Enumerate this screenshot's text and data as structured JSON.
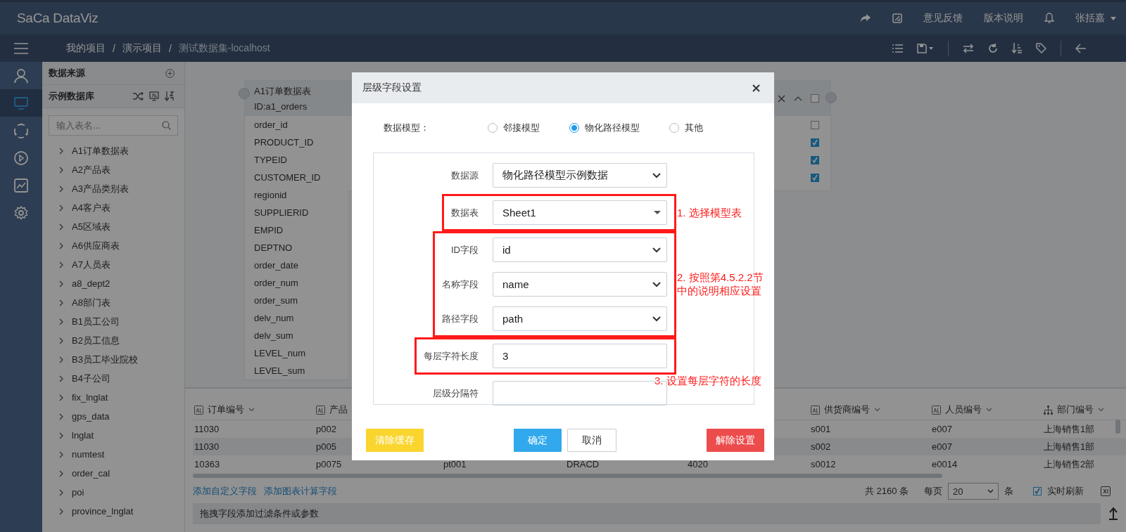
{
  "header": {
    "logo": "SaCa DataViz",
    "links": [
      "意见反馈",
      "版本说明"
    ],
    "user": "张括嘉"
  },
  "breadcrumb": {
    "items": [
      "我的项目",
      "演示项目",
      "测试数据集-localhost"
    ],
    "separator": "/"
  },
  "rail": [
    {
      "kind": "user",
      "selected": false
    },
    {
      "kind": "monitor",
      "selected": true
    },
    {
      "kind": "cycle",
      "selected": false
    },
    {
      "kind": "play",
      "selected": false
    },
    {
      "kind": "chart",
      "selected": false
    },
    {
      "kind": "gear",
      "selected": false
    }
  ],
  "sidebar": {
    "title": "数据来源",
    "database": "示例数据库",
    "search": {
      "placeholder": "输入表名..."
    },
    "tables": [
      "A1订单数据表",
      "A2产品表",
      "A3产品类别表",
      "A4客户表",
      "A5区域表",
      "A6供应商表",
      "A7人员表",
      "a8_dept2",
      "A8部门表",
      "B1员工公司",
      "B2员工信息",
      "B3员工毕业院校",
      "B4子公司",
      "fix_lnglat",
      "gps_data",
      "lnglat",
      "numtest",
      "order_cal",
      "poi",
      "province_lnglat"
    ]
  },
  "card": {
    "title": "A1订单数据表",
    "id": "ID:a1_orders",
    "fields": [
      "order_id",
      "PRODUCT_ID",
      "TYPEID",
      "CUSTOMER_ID",
      "regionid",
      "SUPPLIERID",
      "EMPID",
      "DEPTNO",
      "order_date",
      "order_num",
      "order_sum",
      "delv_num",
      "delv_sum",
      "LEVEL_num",
      "LEVEL_sum"
    ],
    "select_all": {
      "checked": false
    },
    "checkboxes": [
      {
        "checked": false
      },
      {
        "checked": true
      },
      {
        "checked": true
      },
      {
        "checked": true
      }
    ]
  },
  "table": {
    "columns": [
      {
        "label": "订单编号",
        "kind": "text"
      },
      {
        "label": "产品",
        "kind": "text"
      },
      {
        "kind": "hidden"
      },
      {
        "kind": "hidden"
      },
      {
        "kind": "hidden"
      },
      {
        "label": "供货商编号",
        "kind": "text"
      },
      {
        "label": "人员编号",
        "kind": "text"
      },
      {
        "label": "部门编号",
        "kind": "tree"
      }
    ],
    "rows": [
      [
        "11030",
        "p002",
        null,
        null,
        null,
        "s001",
        "e007",
        "上海销售1部"
      ],
      [
        "11030",
        "p005",
        null,
        null,
        null,
        "s002",
        "e007",
        "上海销售1部"
      ],
      [
        "10363",
        "p0075",
        "pt001",
        "DRACD",
        "4020",
        "s0012",
        "e0014",
        "上海销售2部"
      ]
    ],
    "links": [
      "添加自定义字段",
      "添加图表计算字段"
    ],
    "total": "共 2160 条",
    "per_page_label": "每页",
    "page_size": "20",
    "per_page_unit": "条",
    "realtime": {
      "label": "实时刷新",
      "checked": true
    },
    "filter_placeholder": "拖拽字段添加过滤条件或参数"
  },
  "dialog": {
    "title": "层级字段设置",
    "model_label": "数据模型：",
    "models": [
      {
        "label": "邻接模型",
        "selected": false
      },
      {
        "label": "物化路径模型",
        "selected": true
      },
      {
        "label": "其他",
        "selected": false
      }
    ],
    "groups": [
      {
        "highlighted": false,
        "rows": [
          {
            "label": "数据源",
            "value": "物化路径模型示例数据",
            "kind": "select"
          }
        ]
      },
      {
        "highlighted": true,
        "note": "1. 选择模型表",
        "kind": "side_note",
        "rows": [
          {
            "label": "数据表",
            "value": "Sheet1",
            "kind": "combo"
          }
        ]
      },
      {
        "highlighted": true,
        "note": "2. 按照第4.5.2.2节中的说明相应设置",
        "kind": "side_note",
        "rows": [
          {
            "label": "ID字段",
            "value": "id",
            "kind": "select"
          },
          {
            "label": "名称字段",
            "value": "name",
            "kind": "select"
          },
          {
            "label": "路径字段",
            "value": "path",
            "kind": "select"
          }
        ]
      },
      {
        "highlighted": true,
        "note": "3. 设置每层字符的长度",
        "kind": "bottom_note",
        "rows": [
          {
            "label": "每层字符长度",
            "value": "3",
            "kind": "input"
          }
        ]
      },
      {
        "highlighted": false,
        "rows": [
          {
            "label": "层级分隔符",
            "kind": "input"
          }
        ]
      }
    ],
    "buttons": [
      {
        "label": "清除缓存",
        "kind": "warning"
      },
      {
        "label": "确定",
        "kind": "primary"
      },
      {
        "label": "取消",
        "kind": "default"
      },
      {
        "label": "解除设置",
        "kind": "danger"
      }
    ]
  }
}
